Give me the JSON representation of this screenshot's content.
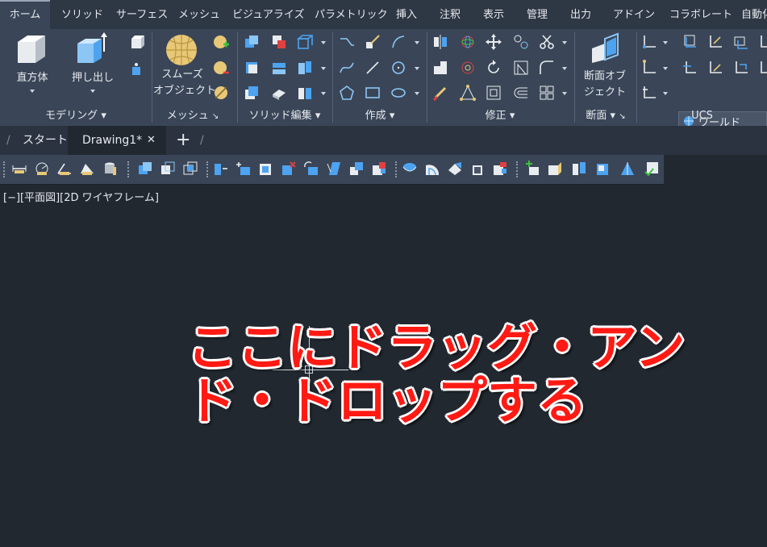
{
  "menu": {
    "tabs": [
      "ホーム",
      "ソリッド",
      "サーフェス",
      "メッシュ",
      "ビジュアライズ",
      "パラメトリック",
      "挿入",
      "注釈",
      "表示",
      "管理",
      "出力",
      "アドイン",
      "コラボレート",
      "自動化"
    ],
    "active": "ホーム"
  },
  "ribbon": {
    "panels": {
      "modeling": "モデリング",
      "mesh": "メッシュ",
      "solid_edit": "ソリッド編集",
      "draw": "作成",
      "modify": "修正",
      "section": "断面",
      "ucs": "UCS"
    },
    "buttons": {
      "box": "直方体",
      "extrude": "押し出し",
      "smooth_object_l1": "スムーズ",
      "smooth_object_l2": "オブジェクト",
      "section_plane_l1": "断面オブ",
      "section_plane_l2": "ジェクト"
    },
    "ucs_dropdown": "ワールド"
  },
  "file_tabs": {
    "start": "スタート",
    "drawing": "Drawing1*",
    "close_glyph": "✕",
    "add_glyph": "+"
  },
  "viewport": {
    "label": "[−][平面図][2D ワイヤフレーム]"
  },
  "overlay": {
    "line1": "ここにドラッグ・アン",
    "line2": "ド・ドロップする"
  },
  "colors": {
    "accent_icon": "#4da3f0",
    "overlay_text": "#ff1a14",
    "ribbon_bg": "#3a4657",
    "canvas_bg": "#212830"
  }
}
